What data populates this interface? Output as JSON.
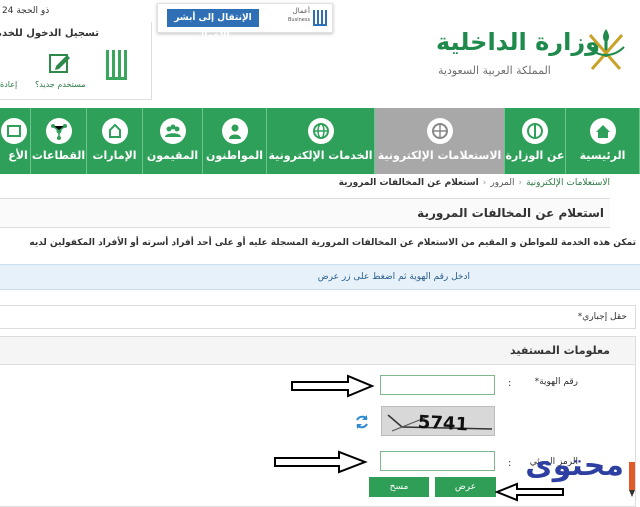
{
  "header": {
    "date": "24 ذو الحجة",
    "login_title": "تسجيل الدخول للخدمات",
    "absher_logo_text": "أبشر",
    "new_user": "مستخدم جديد؟",
    "reset": "إعادة",
    "business_button": "الإنتقال إلى أبشر الأعمال",
    "business_logo_ar": "أعمال",
    "business_logo_en": "Business",
    "ministry_name": "وزارة الداخلية",
    "ministry_sub": "المملكة العربية السعودية"
  },
  "nav": {
    "items": [
      {
        "label": "الرئيسية",
        "icon": "home-icon"
      },
      {
        "label": "عن الوزارة",
        "icon": "emblem-icon"
      },
      {
        "label": "الاستعلامات الإلكترونية",
        "icon": "globe-search-icon",
        "active": true
      },
      {
        "label": "الخدمات الإلكترونية",
        "icon": "globe-icon"
      },
      {
        "label": "المواطنون",
        "icon": "citizen-icon"
      },
      {
        "label": "المقيمون",
        "icon": "residents-icon"
      },
      {
        "label": "الإمارات",
        "icon": "emirates-icon"
      },
      {
        "label": "القطاعات",
        "icon": "sectors-icon"
      },
      {
        "label": "الأع",
        "icon": "news-icon"
      }
    ]
  },
  "breadcrumb": {
    "first": "الاستعلامات الإلكترونية",
    "second": "المرور",
    "current": "استعلام عن المخالفات المرورية"
  },
  "page": {
    "title": "استعلام عن المخالفات المرورية",
    "intro": "تمكن هذه الخدمة للمواطن و المقيم من الاستعلام عن المخالفات المرورية المسجلة عليه أو على أحد أفراد أسرته أو الأفراد المكفولين لديه",
    "info": "ادخل رقم الهوية ثم اضغط على زر عرض",
    "required": "حقل إجباري*"
  },
  "form": {
    "section_title": "معلومات المستفيد",
    "id_label": "رقم الهوية*",
    "colon": ":",
    "captcha_text": "5741",
    "code_label": "الرمز المرئي",
    "view_button": "عرض",
    "clear_button": "مسح"
  },
  "watermark": {
    "text": "محتوى"
  },
  "colors": {
    "green": "#2fa05a",
    "active_tab": "#a8a8a8",
    "blue_button": "#2e6fb5",
    "info_bg": "#e6f1fa"
  }
}
